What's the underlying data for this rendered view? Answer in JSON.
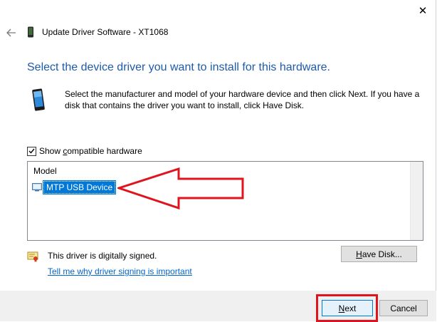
{
  "window": {
    "title": "Update Driver Software - XT1068",
    "close_glyph": "✕",
    "back_glyph": "←"
  },
  "heading": "Select the device driver you want to install for this hardware.",
  "instructions": "Select the manufacturer and model of your hardware device and then click Next. If you have a disk that contains the driver you want to install, click Have Disk.",
  "compatible": {
    "checked": true,
    "label_pre": "Show ",
    "label_key": "c",
    "label_post": "ompatible hardware"
  },
  "model_list": {
    "header": "Model",
    "items": [
      {
        "label": "MTP USB Device",
        "selected": true
      }
    ]
  },
  "signing": {
    "status": "This driver is digitally signed.",
    "link": "Tell me why driver signing is important"
  },
  "buttons": {
    "have_disk_key": "H",
    "have_disk_rest": "ave Disk...",
    "next_key": "N",
    "next_rest": "ext",
    "cancel": "Cancel"
  },
  "annotations": {
    "color": "#e0141e"
  },
  "colors": {
    "heading": "#1d5aab",
    "selection": "#0078d7",
    "link": "#0066cc",
    "footer": "#f0f0f0"
  }
}
